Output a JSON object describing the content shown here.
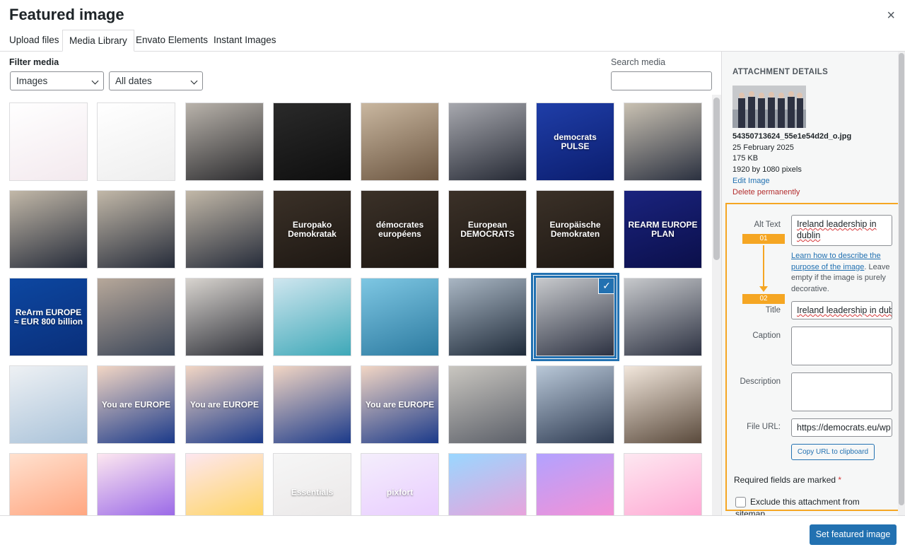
{
  "modal": {
    "title": "Featured image",
    "close_glyph": "×"
  },
  "tabs": [
    {
      "label": "Upload files",
      "active": false
    },
    {
      "label": "Media Library",
      "active": true
    },
    {
      "label": "Envato Elements",
      "active": false
    },
    {
      "label": "Instant Images",
      "active": false
    }
  ],
  "filter": {
    "label": "Filter media",
    "type_value": "Images",
    "date_value": "All dates"
  },
  "search": {
    "label": "Search media",
    "value": ""
  },
  "grid": {
    "items": [
      {
        "label": "",
        "colors": [
          "#ffffff",
          "#f3e9ee"
        ],
        "selected": false
      },
      {
        "label": "",
        "colors": [
          "#ffffff",
          "#eeeeee"
        ],
        "selected": false
      },
      {
        "label": "",
        "colors": [
          "#b9b3ab",
          "#2b2b2e"
        ],
        "selected": false
      },
      {
        "label": "",
        "colors": [
          "#2a2a2a",
          "#0e0e0e"
        ],
        "selected": false
      },
      {
        "label": "",
        "colors": [
          "#c9b7a0",
          "#6b5540"
        ],
        "selected": false
      },
      {
        "label": "",
        "colors": [
          "#a7a8ae",
          "#262a35"
        ],
        "selected": false
      },
      {
        "label": "democrats PULSE",
        "colors": [
          "#1f3ea8",
          "#0b1d6e"
        ],
        "selected": false
      },
      {
        "label": "",
        "colors": [
          "#c9c1b2",
          "#2b3140"
        ],
        "selected": false
      },
      {
        "label": "",
        "colors": [
          "#c2b8a8",
          "#262c3a"
        ],
        "selected": false
      },
      {
        "label": "",
        "colors": [
          "#c2b8a8",
          "#262c3a"
        ],
        "selected": false
      },
      {
        "label": "",
        "colors": [
          "#c2b8a8",
          "#262c3a"
        ],
        "selected": false
      },
      {
        "label": "Europako Demokratak",
        "colors": [
          "#3b3128",
          "#1d1712"
        ],
        "selected": false
      },
      {
        "label": "démocrates européens",
        "colors": [
          "#3b3128",
          "#1d1712"
        ],
        "selected": false
      },
      {
        "label": "European DEMOCRATS",
        "colors": [
          "#3b3128",
          "#1d1712"
        ],
        "selected": false
      },
      {
        "label": "Europäische Demokraten",
        "colors": [
          "#3b3128",
          "#1d1712"
        ],
        "selected": false
      },
      {
        "label": "REARM EUROPE PLAN",
        "colors": [
          "#1a237e",
          "#0b0f4a"
        ],
        "selected": false
      },
      {
        "label": "ReArm EUROPE ≈ EUR 800 billion",
        "colors": [
          "#0d47a1",
          "#0a2f7a"
        ],
        "selected": false
      },
      {
        "label": "",
        "colors": [
          "#b7a89a",
          "#3a4558"
        ],
        "selected": false
      },
      {
        "label": "",
        "colors": [
          "#d8d4cf",
          "#2e3038"
        ],
        "selected": false
      },
      {
        "label": "",
        "colors": [
          "#cfe6ef",
          "#3ea8b8"
        ],
        "selected": false
      },
      {
        "label": "",
        "colors": [
          "#7ec7e3",
          "#2c7aa0"
        ],
        "selected": false
      },
      {
        "label": "",
        "colors": [
          "#a9b6c3",
          "#1f2b3a"
        ],
        "selected": false
      },
      {
        "label": "",
        "colors": [
          "#c7c9cc",
          "#2d3242"
        ],
        "selected": true
      },
      {
        "label": "",
        "colors": [
          "#c7c9cc",
          "#2d3242"
        ],
        "selected": false
      },
      {
        "label": "",
        "colors": [
          "#eef1f4",
          "#a9c2d9"
        ],
        "selected": false
      },
      {
        "label": "You are EUROPE",
        "colors": [
          "#f2d6c4",
          "#1b3a8a"
        ],
        "selected": false
      },
      {
        "label": "You are EUROPE",
        "colors": [
          "#f2d6c4",
          "#1b3a8a"
        ],
        "selected": false
      },
      {
        "label": "",
        "colors": [
          "#f2d6c4",
          "#1b3a8a"
        ],
        "selected": false
      },
      {
        "label": "You are EUROPE",
        "colors": [
          "#f2d6c4",
          "#1b3a8a"
        ],
        "selected": false
      },
      {
        "label": "",
        "colors": [
          "#c9c6c0",
          "#5b5f68"
        ],
        "selected": false
      },
      {
        "label": "",
        "colors": [
          "#b9c8d8",
          "#2e3b52"
        ],
        "selected": false
      },
      {
        "label": "",
        "colors": [
          "#f2e7dc",
          "#5a4a3c"
        ],
        "selected": false
      },
      {
        "label": "",
        "colors": [
          "#ffe1cf",
          "#ff9c73"
        ],
        "selected": false
      },
      {
        "label": "",
        "colors": [
          "#fde7f0",
          "#8a54e6"
        ],
        "selected": false
      },
      {
        "label": "",
        "colors": [
          "#fde7f0",
          "#ffd24d"
        ],
        "selected": false
      },
      {
        "label": "Essentials",
        "colors": [
          "#f6f6f6",
          "#e9e6e6"
        ],
        "selected": false
      },
      {
        "label": "pixfort",
        "colors": [
          "#f4eefc",
          "#e7c7ff"
        ],
        "selected": false
      },
      {
        "label": "",
        "colors": [
          "#9ad7ff",
          "#f59ad6"
        ],
        "selected": false
      },
      {
        "label": "",
        "colors": [
          "#b2a2ff",
          "#ff8ecf"
        ],
        "selected": false
      },
      {
        "label": "",
        "colors": [
          "#fde8f1",
          "#ff9fcf"
        ],
        "selected": false
      }
    ]
  },
  "attachment": {
    "heading": "ATTACHMENT DETAILS",
    "filename": "54350713624_55e1e54d2d_o.jpg",
    "date": "25 February 2025",
    "size": "175 KB",
    "dimensions": "1920 by 1080 pixels",
    "edit_link": "Edit Image",
    "delete_link": "Delete permanently",
    "alt_label": "Alt Text",
    "alt_value": "Ireland leadership in dublin",
    "step1": "01",
    "step2": "02",
    "help_link": "Learn how to describe the purpose of the image",
    "help_rest": ". Leave empty if the image is purely decorative.",
    "title_label": "Title",
    "title_value": "Ireland leadership in dublin",
    "caption_label": "Caption",
    "caption_value": "",
    "description_label": "Description",
    "description_value": "",
    "file_url_label": "File URL:",
    "file_url_value": "https://democrats.eu/wp",
    "copy_url": "Copy URL to clipboard",
    "required_text": "Required fields are marked",
    "required_star": "*",
    "exclude_line1": "Exclude this attachment from",
    "exclude_line2": "sitemap"
  },
  "footer": {
    "primary_button": "Set featured image"
  },
  "colors": {
    "accent": "#2271b1",
    "highlight": "#f5a623",
    "danger": "#b32d2e"
  }
}
